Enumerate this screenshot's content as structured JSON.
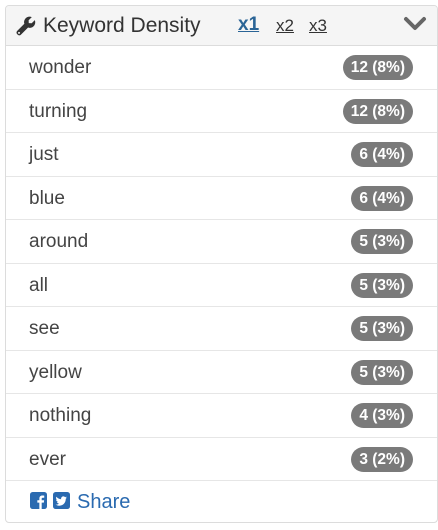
{
  "header": {
    "title": "Keyword Density",
    "tabs": [
      {
        "label": "x1",
        "active": true
      },
      {
        "label": "x2",
        "active": false
      },
      {
        "label": "x3",
        "active": false
      }
    ],
    "icons": {
      "wrench": "wrench-icon",
      "collapse": "chevron-down-icon"
    }
  },
  "keywords": [
    {
      "word": "wonder",
      "count": "12 (8%)"
    },
    {
      "word": "turning",
      "count": "12 (8%)"
    },
    {
      "word": "just",
      "count": "6 (4%)"
    },
    {
      "word": "blue",
      "count": "6 (4%)"
    },
    {
      "word": "around",
      "count": "5 (3%)"
    },
    {
      "word": "all",
      "count": "5 (3%)"
    },
    {
      "word": "see",
      "count": "5 (3%)"
    },
    {
      "word": "yellow",
      "count": "5 (3%)"
    },
    {
      "word": "nothing",
      "count": "4 (3%)"
    },
    {
      "word": "ever",
      "count": "3 (2%)"
    }
  ],
  "footer": {
    "share_label": "Share",
    "icons": [
      "facebook-icon",
      "twitter-icon"
    ]
  },
  "colors": {
    "link": "#2a6ab0",
    "active_tab": "#2a6496",
    "badge": "#7a7a7a",
    "header_bg": "#f5f5f5"
  }
}
